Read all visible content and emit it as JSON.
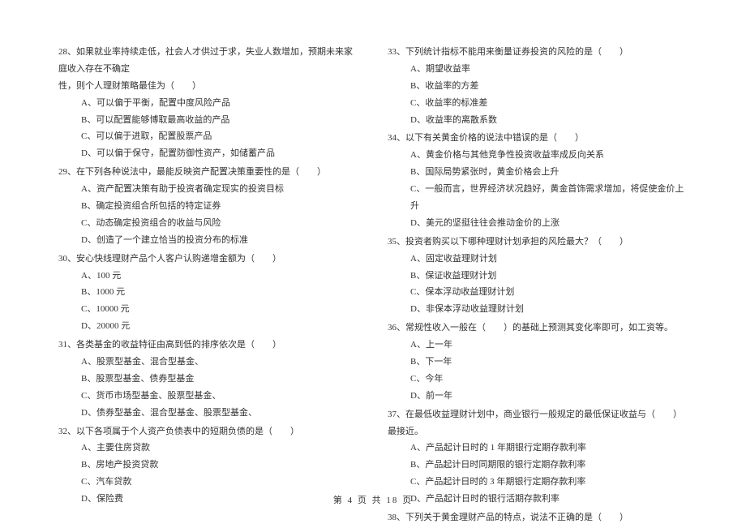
{
  "left": {
    "q28": {
      "line1": "28、如果就业率持续走低，社会人才供过于求，失业人数增加，预期未来家庭收入存在不确定",
      "line2": "性，则个人理财策略最佳为（　　）",
      "a": "A、可以偏于平衡，配置中度风险产品",
      "b": "B、可以配置能够博取最高收益的产品",
      "c": "C、可以偏于进取，配置股票产品",
      "d": "D、可以偏于保守，配置防御性资产，如储蓄产品"
    },
    "q29": {
      "text": "29、在下列各种说法中，最能反映资产配置决策重要性的是（　　）",
      "a": "A、资产配置决策有助于投资者确定现实的投资目标",
      "b": "B、确定投资组合所包括的特定证券",
      "c": "C、动态确定投资组合的收益与风险",
      "d": "D、创造了一个建立恰当的投资分布的标准"
    },
    "q30": {
      "text": "30、安心快线理财产品个人客户认购递增金额为（　　）",
      "a": "A、100 元",
      "b": "B、1000 元",
      "c": "C、10000 元",
      "d": "D、20000 元"
    },
    "q31": {
      "text": "31、各类基金的收益特征由高到低的排序依次是（　　）",
      "a": "A、股票型基金、混合型基金、",
      "b": "B、股票型基金、债券型基金",
      "c": "C、货币市场型基金、股票型基金、",
      "d": "D、债券型基金、混合型基金、股票型基金、"
    },
    "q32": {
      "text": "32、以下各项属于个人资产负债表中的短期负债的是（　　）",
      "a": "A、主要住房贷款",
      "b": "B、房地产投资贷款",
      "c": "C、汽车贷款",
      "d": "D、保险费"
    }
  },
  "right": {
    "q33": {
      "text": "33、下列统计指标不能用来衡量证券投资的风险的是（　　）",
      "a": "A、期望收益率",
      "b": "B、收益率的方差",
      "c": "C、收益率的标准差",
      "d": "D、收益率的离散系数"
    },
    "q34": {
      "text": "34、以下有关黄金价格的说法中错误的是（　　）",
      "a": "A、黄金价格与其他竞争性投资收益率成反向关系",
      "b": "B、国际局势紧张时，黄金价格会上升",
      "c": "C、一般而言，世界经济状况趋好，黄金首饰需求增加，将促使金价上升",
      "d": "D、美元的坚挺往往会推动金价的上涨"
    },
    "q35": {
      "text": "35、投资者购买以下哪种理财计划承担的风险最大？（　　）",
      "a": "A、固定收益理财计划",
      "b": "B、保证收益理财计划",
      "c": "C、保本浮动收益理财计划",
      "d": "D、非保本浮动收益理财计划"
    },
    "q36": {
      "text": "36、常规性收入一般在（　　）的基础上预测其变化率即可，如工资等。",
      "a": "A、上一年",
      "b": "B、下一年",
      "c": "C、今年",
      "d": "D、前一年"
    },
    "q37": {
      "text": "37、在最低收益理财计划中，商业银行一般规定的最低保证收益与（　　）最接近。",
      "a": "A、产品起计日时的 1 年期银行定期存款利率",
      "b": "B、产品起计日时同期限的银行定期存款利率",
      "c": "C、产品起计日时的 3 年期银行定期存款利率",
      "d": "D、产品起计日时的银行活期存款利率"
    },
    "q38": {
      "text": "38、下列关于黄金理财产品的特点，说法不正确的是（　　）"
    }
  },
  "footer": "第 4 页 共 18 页"
}
